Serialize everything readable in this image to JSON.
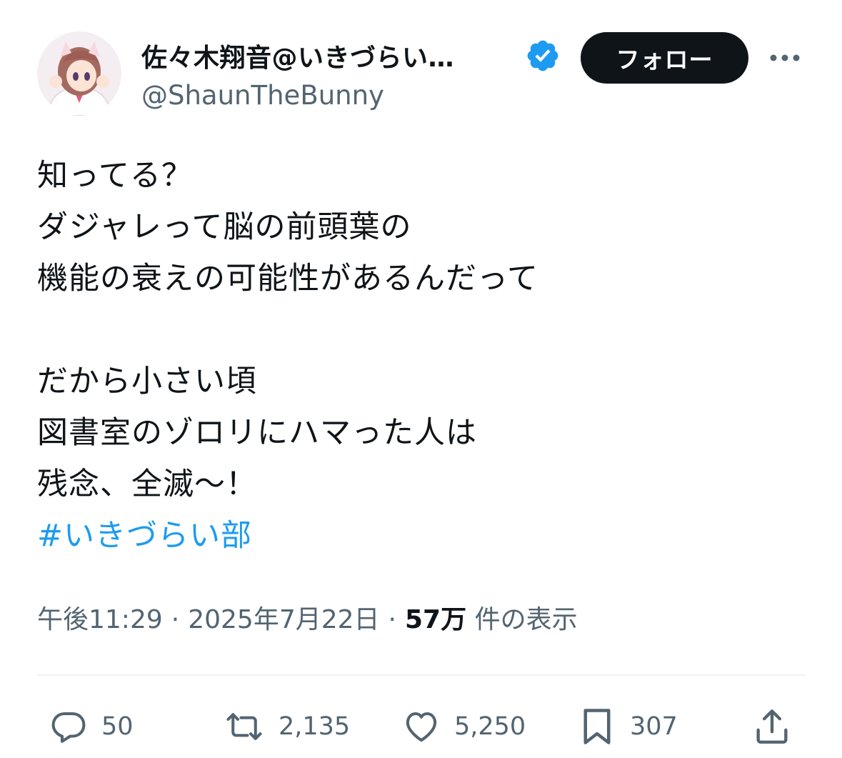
{
  "author": {
    "display_name": "佐々木翔音@いきづらい…",
    "handle": "@ShaunTheBunny",
    "verified_icon": "verified-badge-icon",
    "avatar_icon": "avatar"
  },
  "header": {
    "follow_label": "フォロー",
    "more_icon": "more-options-icon"
  },
  "tweet": {
    "lines": [
      "知ってる？",
      "ダジャレって脳の前頭葉の",
      "機能の衰えの可能性があるんだって",
      "",
      "だから小さい頃",
      "図書室のゾロリにハマった人は",
      "残念、全滅〜！"
    ],
    "hashtag": "#いきづらい部"
  },
  "meta": {
    "time": "午後11:29",
    "separator": "·",
    "date": "2025年7月22日",
    "views_count": "57万",
    "views_label": "件の表示"
  },
  "actions": {
    "replies": "50",
    "retweets": "2,135",
    "likes": "5,250",
    "bookmarks": "307"
  },
  "colors": {
    "text": "#0f1419",
    "secondary": "#536471",
    "accent": "#1d9bf0",
    "follow_bg": "#0f1419"
  }
}
